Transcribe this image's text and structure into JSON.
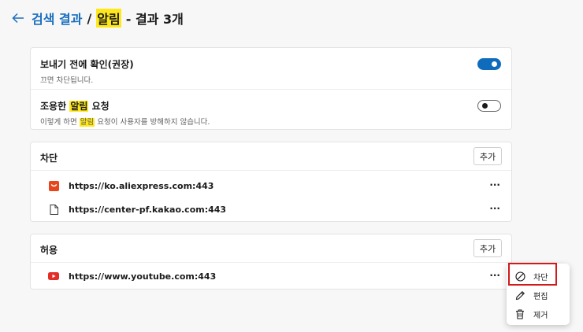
{
  "header": {
    "crumb_link": "검색 결과",
    "separator": "/",
    "query": "알림",
    "result_count": "- 결과 3개"
  },
  "settings": [
    {
      "title": "보내기 전에 확인(권장)",
      "description": "끄면 차단됩니다.",
      "enabled": true
    },
    {
      "title_before": "조용한 ",
      "title_highlight": "알림",
      "title_after": " 요청",
      "desc_before": "이렇게 하면 ",
      "desc_highlight": "알림",
      "desc_after": " 요청이 사용자를 방해하지 않습니다.",
      "enabled": false
    }
  ],
  "block_section": {
    "title": "차단",
    "add_label": "추가",
    "sites": [
      {
        "url": "https://ko.aliexpress.com:443",
        "icon": "aliexpress-icon",
        "more": "···"
      },
      {
        "url": "https://center-pf.kakao.com:443",
        "icon": "document-icon",
        "more": "···"
      }
    ]
  },
  "allow_section": {
    "title": "허용",
    "add_label": "추가",
    "sites": [
      {
        "url": "https://www.youtube.com:443",
        "icon": "youtube-icon",
        "more": "···"
      }
    ]
  },
  "context_menu": {
    "items": [
      {
        "label": "차단",
        "icon": "block-icon"
      },
      {
        "label": "편집",
        "icon": "pencil-icon"
      },
      {
        "label": "제거",
        "icon": "trash-icon"
      }
    ]
  },
  "colors": {
    "accent": "#0f6cbd",
    "highlight": "#ffe81a",
    "annotation": "#d11a1a"
  }
}
